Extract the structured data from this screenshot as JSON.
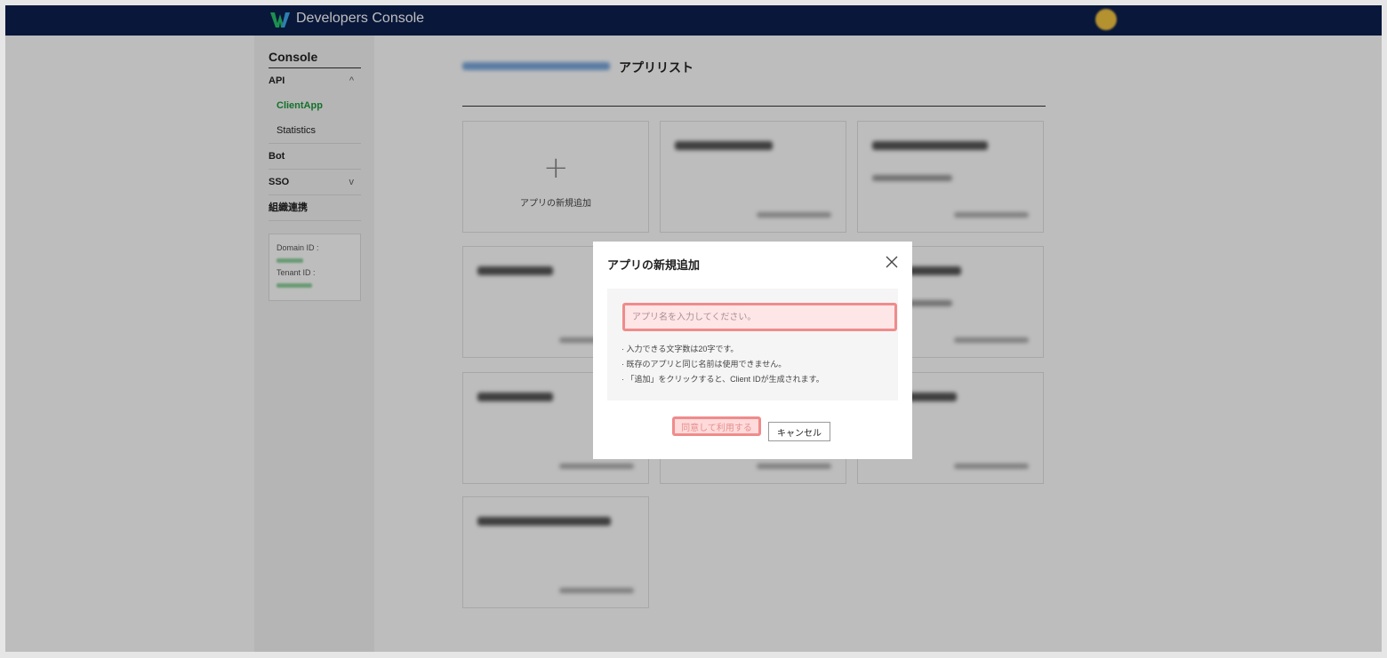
{
  "header": {
    "brand": "Developers Console"
  },
  "sidebar": {
    "title": "Console",
    "api": {
      "label": "API",
      "chevron": "^"
    },
    "api_items": [
      {
        "label": "ClientApp"
      },
      {
        "label": "Statistics"
      }
    ],
    "bot": {
      "label": "Bot"
    },
    "sso": {
      "label": "SSO",
      "chevron": "v"
    },
    "org": {
      "label": "組織連携"
    },
    "domain_id_label": "Domain ID :",
    "tenant_id_label": "Tenant ID :"
  },
  "main": {
    "title": "アプリリスト",
    "add_card_label": "アプリの新規追加"
  },
  "modal": {
    "title": "アプリの新規追加",
    "input_placeholder": "アプリ名を入力してください。",
    "notes": [
      "入力できる文字数は20字です。",
      "既存のアプリと同じ名前は使用できません。",
      "「追加」をクリックすると、Client IDが生成されます。"
    ],
    "agree_button": "同意して利用する",
    "cancel_button": "キャンセル"
  },
  "colors": {
    "header_bg": "#0b1f4f",
    "active_green": "#1a9a3a",
    "highlight_red": "#f08b8b"
  },
  "icons": {
    "logo": "works-logo-icon",
    "close": "close-icon",
    "plus": "plus-icon",
    "chevron": "chevron-icon"
  }
}
